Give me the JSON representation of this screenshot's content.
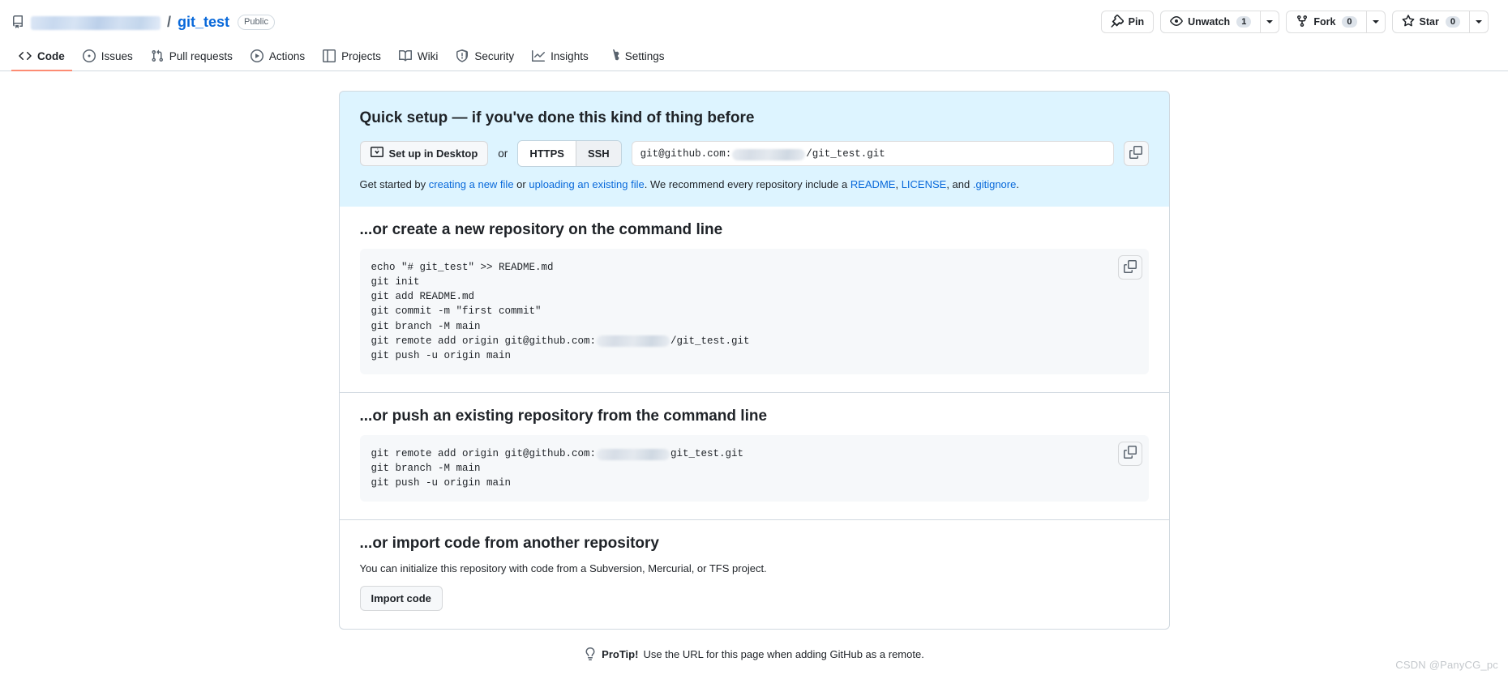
{
  "header": {
    "repo_icon": "repo-icon",
    "owner_redacted": true,
    "separator": "/",
    "repo_name": "git_test",
    "visibility": "Public",
    "actions": {
      "pin_label": "Pin",
      "unwatch_label": "Unwatch",
      "unwatch_count": "1",
      "fork_label": "Fork",
      "fork_count": "0",
      "star_label": "Star",
      "star_count": "0"
    }
  },
  "nav": {
    "tabs": [
      {
        "label": "Code",
        "icon": "code-icon",
        "active": true
      },
      {
        "label": "Issues",
        "icon": "issue-opened-icon",
        "active": false
      },
      {
        "label": "Pull requests",
        "icon": "git-pull-request-icon",
        "active": false
      },
      {
        "label": "Actions",
        "icon": "play-icon",
        "active": false
      },
      {
        "label": "Projects",
        "icon": "table-icon",
        "active": false
      },
      {
        "label": "Wiki",
        "icon": "book-icon",
        "active": false
      },
      {
        "label": "Security",
        "icon": "shield-icon",
        "active": false
      },
      {
        "label": "Insights",
        "icon": "graph-icon",
        "active": false
      },
      {
        "label": "Settings",
        "icon": "gear-icon",
        "active": false
      }
    ]
  },
  "quick_setup": {
    "title": "Quick setup — if you've done this kind of thing before",
    "desktop_button": "Set up in Desktop",
    "or_text": "or",
    "protocols": [
      {
        "label": "HTTPS",
        "selected": false
      },
      {
        "label": "SSH",
        "selected": true
      }
    ],
    "clone_url_prefix": "git@github.com:",
    "clone_url_suffix": "/git_test.git",
    "copy_icon": "copy-icon",
    "note": {
      "lead": "Get started by ",
      "link_new_file": "creating a new file",
      "mid1": " or ",
      "link_upload": "uploading an existing file",
      "mid2": ". We recommend every repository include a ",
      "link_readme": "README",
      "comma1": ", ",
      "link_license": "LICENSE",
      "mid3": ", and ",
      "link_gitignore": ".gitignore",
      "end": "."
    }
  },
  "create_section": {
    "title": "...or create a new repository on the command line",
    "code_line_1": "echo \"# git_test\" >> README.md",
    "code_line_2": "git init",
    "code_line_3": "git add README.md",
    "code_line_4": "git commit -m \"first commit\"",
    "code_line_5": "git branch -M main",
    "code_line_6_prefix": "git remote add origin git@github.com:",
    "code_line_6_suffix": "/git_test.git",
    "code_line_7": "git push -u origin main",
    "copy_icon": "copy-icon"
  },
  "push_section": {
    "title": "...or push an existing repository from the command line",
    "code_line_1_prefix": "git remote add origin git@github.com:",
    "code_line_1_suffix": "git_test.git",
    "code_line_2": "git branch -M main",
    "code_line_3": "git push -u origin main",
    "copy_icon": "copy-icon"
  },
  "import_section": {
    "title": "...or import code from another repository",
    "description": "You can initialize this repository with code from a Subversion, Mercurial, or TFS project.",
    "button_label": "Import code"
  },
  "footer": {
    "protip_icon": "light-bulb-icon",
    "protip_label": "ProTip!",
    "protip_text": "Use the URL for this page when adding GitHub as a remote.",
    "watermark": "CSDN @PanyCG_pc"
  },
  "colors": {
    "accent": "#0969da",
    "active_tab_underline": "#fd8c73",
    "quick_setup_bg": "#ddf4ff",
    "code_bg": "#f6f8fa",
    "border": "#d1d9e0"
  }
}
